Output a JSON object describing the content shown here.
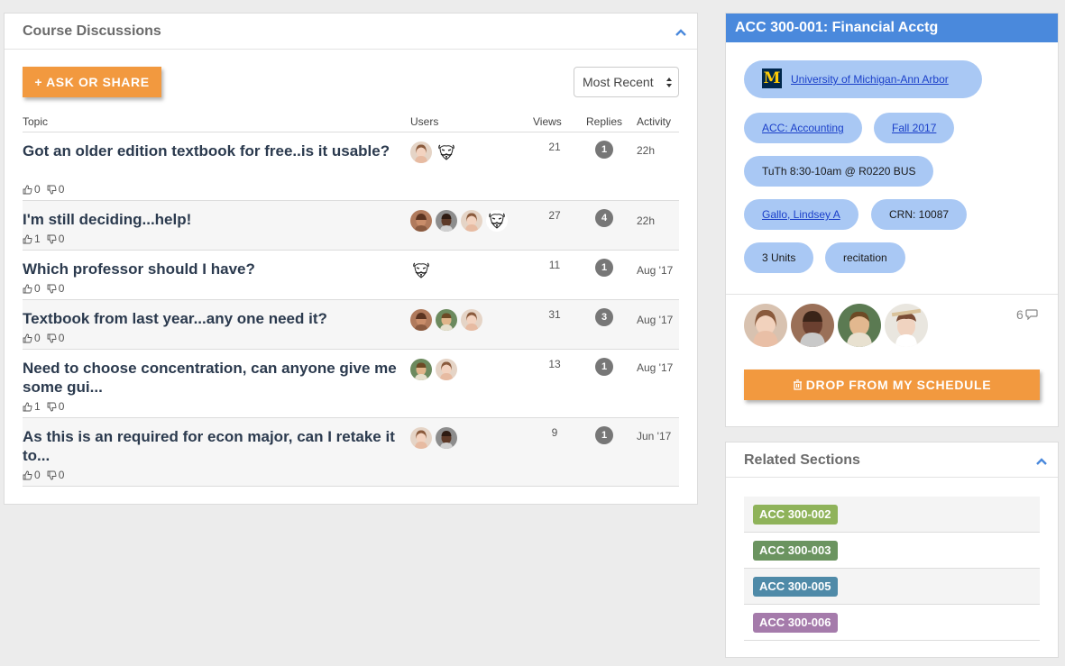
{
  "discussions": {
    "title": "Course Discussions",
    "ask_button": "+ ASK OR SHARE",
    "sort": {
      "selected": "Most Recent"
    },
    "columns": {
      "topic": "Topic",
      "users": "Users",
      "views": "Views",
      "replies": "Replies",
      "activity": "Activity"
    },
    "rows": [
      {
        "topic": "Got an older edition textbook for free..is it usable?",
        "likes": "0",
        "dislikes": "0",
        "views": "21",
        "replies": "1",
        "activity": "22h",
        "users": [
          "woman-1",
          "anon-mask"
        ]
      },
      {
        "topic": "I'm still deciding...help!",
        "likes": "1",
        "dislikes": "0",
        "views": "27",
        "replies": "4",
        "activity": "22h",
        "users": [
          "woman-2",
          "man-dark",
          "woman-1",
          "anon-mask"
        ]
      },
      {
        "topic": "Which professor should I have?",
        "likes": "0",
        "dislikes": "0",
        "views": "11",
        "replies": "1",
        "activity": "Aug '17",
        "users": [
          "anon-mask"
        ]
      },
      {
        "topic": "Textbook from last year...any one need it?",
        "likes": "0",
        "dislikes": "0",
        "views": "31",
        "replies": "3",
        "activity": "Aug '17",
        "users": [
          "woman-2",
          "man-light",
          "woman-1"
        ]
      },
      {
        "topic": "Need to choose concentration, can anyone give me some gui...",
        "likes": "1",
        "dislikes": "0",
        "views": "13",
        "replies": "1",
        "activity": "Aug '17",
        "users": [
          "man-light",
          "woman-1"
        ]
      },
      {
        "topic": "As this is an required for econ major, can I retake it to...",
        "likes": "0",
        "dislikes": "0",
        "views": "9",
        "replies": "1",
        "activity": "Jun '17",
        "users": [
          "woman-1",
          "man-dark"
        ]
      }
    ]
  },
  "course": {
    "title": "ACC 300-001: Financial Acctg",
    "university": "University of Michigan-Ann Arbor",
    "university_logo": "M",
    "subject": "ACC: Accounting",
    "term": "Fall 2017",
    "schedule": "TuTh 8:30-10am @ R0220 BUS",
    "instructor": "Gallo, Lindsey A",
    "crn": "CRN: 10087",
    "units": "3 Units",
    "type": "recitation",
    "message_count": "6",
    "drop_button": "DROP FROM MY SCHEDULE"
  },
  "related": {
    "title": "Related Sections",
    "sections": [
      {
        "label": "ACC 300-002",
        "color": "#8fb35a"
      },
      {
        "label": "ACC 300-003",
        "color": "#6b9460"
      },
      {
        "label": "ACC 300-005",
        "color": "#4f8aa8"
      },
      {
        "label": "ACC 300-006",
        "color": "#a57bab"
      }
    ]
  },
  "colors": {
    "accent_orange": "#f2993f",
    "header_blue": "#4a89dc",
    "pill_blue": "#a9c8f4"
  }
}
